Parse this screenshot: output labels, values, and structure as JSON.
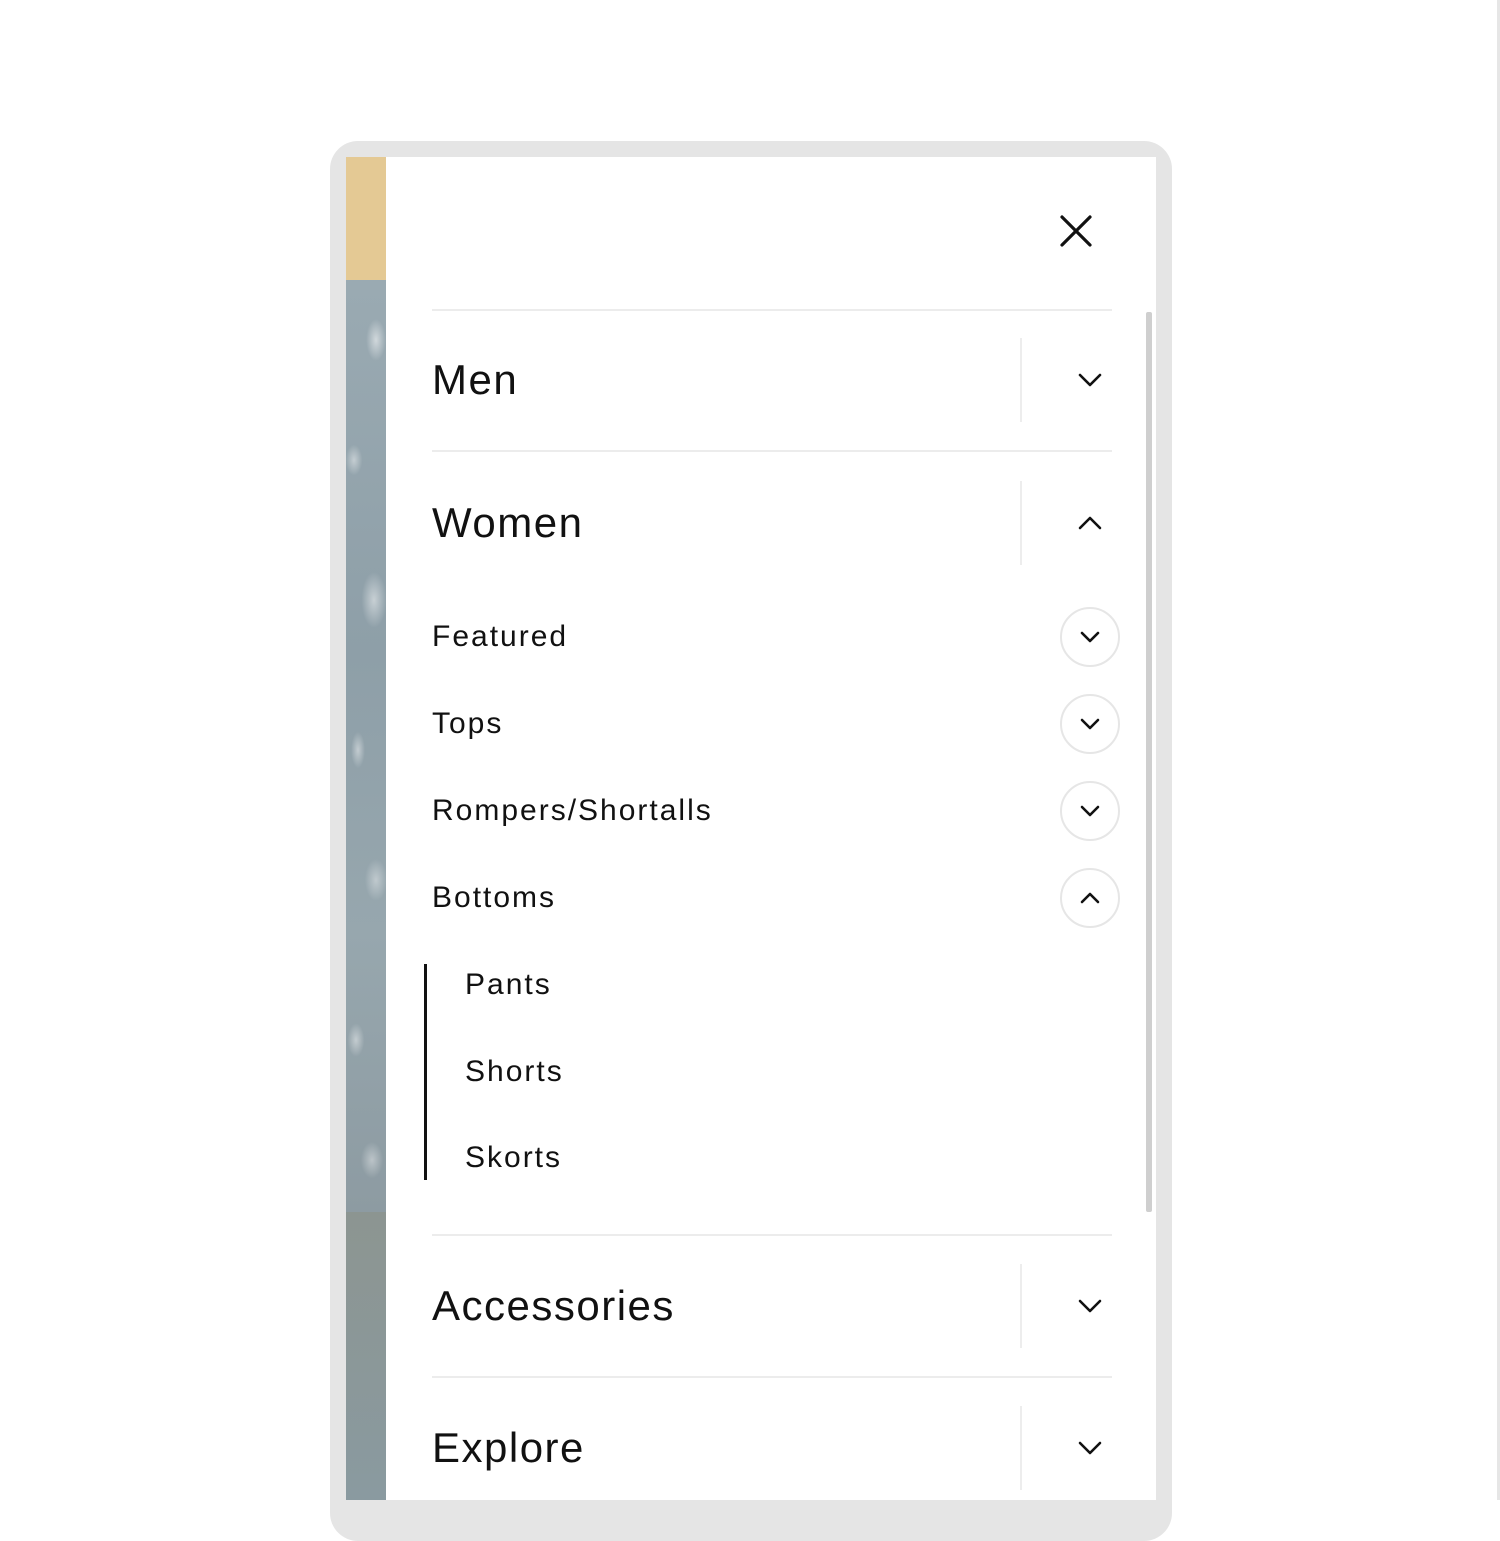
{
  "theme": {
    "text_color": "#111111",
    "divider_color": "#ececec",
    "banner_color": "#e4c994",
    "device_frame_color": "#e5e5e5"
  },
  "menu": {
    "close_icon": "close-icon",
    "categories": [
      {
        "label": "Men",
        "state": "collapsed",
        "icon": "chevron-down-icon"
      },
      {
        "label": "Women",
        "state": "expanded",
        "icon": "chevron-up-icon",
        "subcategories": [
          {
            "label": "Featured",
            "state": "collapsed",
            "icon": "chevron-down-icon"
          },
          {
            "label": "Tops",
            "state": "collapsed",
            "icon": "chevron-down-icon"
          },
          {
            "label": "Rompers/Shortalls",
            "state": "collapsed",
            "icon": "chevron-down-icon"
          },
          {
            "label": "Bottoms",
            "state": "expanded",
            "icon": "chevron-up-icon",
            "items": [
              {
                "label": "Pants"
              },
              {
                "label": "Shorts"
              },
              {
                "label": "Skorts"
              }
            ]
          }
        ]
      },
      {
        "label": "Accessories",
        "state": "collapsed",
        "icon": "chevron-down-icon"
      },
      {
        "label": "Explore",
        "state": "collapsed",
        "icon": "chevron-down-icon"
      }
    ]
  }
}
